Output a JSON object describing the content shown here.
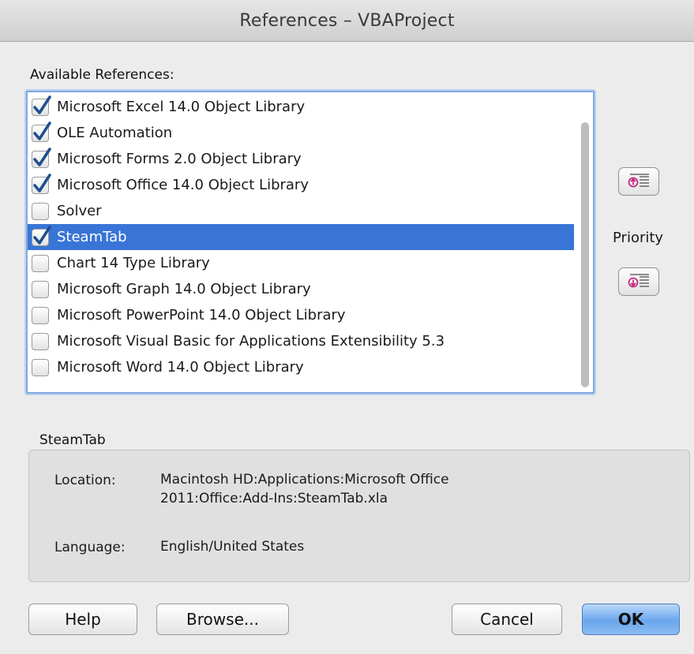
{
  "window": {
    "title": "References – VBAProject"
  },
  "available_references": {
    "label": "Available References:",
    "items": [
      {
        "label": "Microsoft Excel 14.0 Object Library",
        "checked": true,
        "selected": false
      },
      {
        "label": "OLE Automation",
        "checked": true,
        "selected": false
      },
      {
        "label": "Microsoft Forms 2.0 Object Library",
        "checked": true,
        "selected": false
      },
      {
        "label": "Microsoft Office 14.0 Object Library",
        "checked": true,
        "selected": false
      },
      {
        "label": "Solver",
        "checked": false,
        "selected": false
      },
      {
        "label": "SteamTab",
        "checked": true,
        "selected": true
      },
      {
        "label": "Chart 14 Type Library",
        "checked": false,
        "selected": false
      },
      {
        "label": "Microsoft Graph 14.0 Object Library",
        "checked": false,
        "selected": false
      },
      {
        "label": "Microsoft PowerPoint 14.0 Object Library",
        "checked": false,
        "selected": false
      },
      {
        "label": "Microsoft Visual Basic for Applications Extensibility 5.3",
        "checked": false,
        "selected": false
      },
      {
        "label": "Microsoft Word 14.0 Object Library",
        "checked": false,
        "selected": false
      }
    ]
  },
  "priority": {
    "label": "Priority",
    "up_icon": "priority-up-icon",
    "down_icon": "priority-down-icon"
  },
  "details": {
    "name": "SteamTab",
    "location_label": "Location:",
    "location_line1": "Macintosh HD:Applications:Microsoft Office",
    "location_line2": "2011:Office:Add-Ins:SteamTab.xla",
    "language_label": "Language:",
    "language_value": "English/United States"
  },
  "buttons": {
    "help": "Help",
    "browse": "Browse...",
    "cancel": "Cancel",
    "ok": "OK"
  },
  "colors": {
    "selection": "#3875d7",
    "checkmark": "#1f4f8f",
    "default_button": "#6aa6ec"
  }
}
